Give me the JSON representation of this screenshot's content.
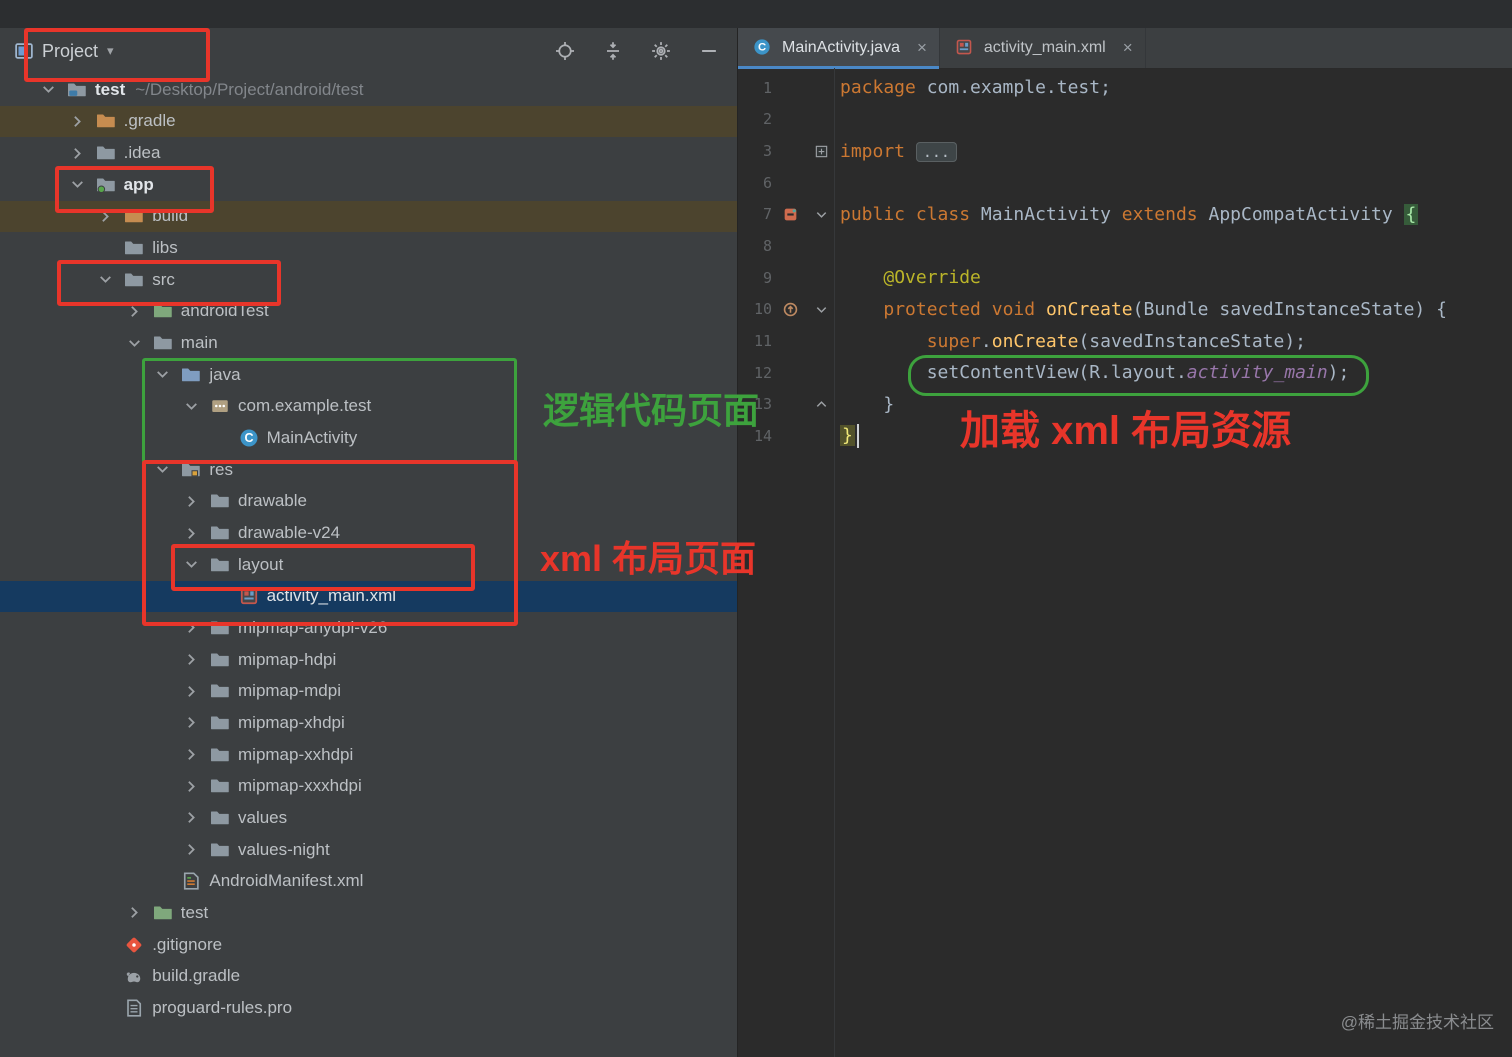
{
  "window": {
    "watermark": "@稀土掘金技术社区"
  },
  "colors": {
    "annotation_red": "#e8352a",
    "annotation_green": "#3da23d",
    "selection_blue": "#153a60",
    "modified_row": "#4c442e",
    "keyword_orange": "#cc7832",
    "editor_bg": "#2b2b2b",
    "panel_bg": "#3c3f41",
    "tab_underline": "#4a88c7"
  },
  "project_panel": {
    "header": {
      "title": "Project",
      "caret": "▾",
      "icons": [
        "locate",
        "collapse-all",
        "settings",
        "hide"
      ]
    },
    "tree": [
      {
        "label": "test",
        "suffix": "~/Desktop/Project/android/test",
        "level": 0,
        "chevron": "expanded",
        "icon": "folder-root",
        "bold": true
      },
      {
        "label": ".gradle",
        "level": 1,
        "chevron": "collapsed",
        "icon": "folder-gradle",
        "row": "modified"
      },
      {
        "label": ".idea",
        "level": 1,
        "chevron": "collapsed",
        "icon": "folder"
      },
      {
        "label": "app",
        "level": 1,
        "chevron": "expanded",
        "icon": "folder-module",
        "bold": true
      },
      {
        "label": "build",
        "level": 2,
        "chevron": "collapsed",
        "icon": "folder-build",
        "row": "modified"
      },
      {
        "label": "libs",
        "level": 2,
        "chevron": null,
        "icon": "folder"
      },
      {
        "label": "src",
        "level": 2,
        "chevron": "expanded",
        "icon": "folder"
      },
      {
        "label": "androidTest",
        "level": 3,
        "chevron": "collapsed",
        "icon": "folder-test"
      },
      {
        "label": "main",
        "level": 3,
        "chevron": "expanded",
        "icon": "folder"
      },
      {
        "label": "java",
        "level": 4,
        "chevron": "expanded",
        "icon": "folder-src"
      },
      {
        "label": "com.example.test",
        "level": 5,
        "chevron": "expanded",
        "icon": "package"
      },
      {
        "label": "MainActivity",
        "level": 6,
        "chevron": null,
        "icon": "class"
      },
      {
        "label": "res",
        "level": 4,
        "chevron": "expanded",
        "icon": "folder-res"
      },
      {
        "label": "drawable",
        "level": 5,
        "chevron": "collapsed",
        "icon": "folder"
      },
      {
        "label": "drawable-v24",
        "level": 5,
        "chevron": "collapsed",
        "icon": "folder"
      },
      {
        "label": "layout",
        "level": 5,
        "chevron": "expanded",
        "icon": "folder"
      },
      {
        "label": "activity_main.xml",
        "level": 6,
        "chevron": null,
        "icon": "layout-xml",
        "row": "selected"
      },
      {
        "label": "mipmap-anydpi-v26",
        "level": 5,
        "chevron": "collapsed",
        "icon": "folder"
      },
      {
        "label": "mipmap-hdpi",
        "level": 5,
        "chevron": "collapsed",
        "icon": "folder"
      },
      {
        "label": "mipmap-mdpi",
        "level": 5,
        "chevron": "collapsed",
        "icon": "folder"
      },
      {
        "label": "mipmap-xhdpi",
        "level": 5,
        "chevron": "collapsed",
        "icon": "folder"
      },
      {
        "label": "mipmap-xxhdpi",
        "level": 5,
        "chevron": "collapsed",
        "icon": "folder"
      },
      {
        "label": "mipmap-xxxhdpi",
        "level": 5,
        "chevron": "collapsed",
        "icon": "folder"
      },
      {
        "label": "values",
        "level": 5,
        "chevron": "collapsed",
        "icon": "folder"
      },
      {
        "label": "values-night",
        "level": 5,
        "chevron": "collapsed",
        "icon": "folder"
      },
      {
        "label": "AndroidManifest.xml",
        "level": 4,
        "chevron": null,
        "icon": "manifest"
      },
      {
        "label": "test",
        "level": 3,
        "chevron": "collapsed",
        "icon": "folder-test"
      },
      {
        "label": ".gitignore",
        "level": 2,
        "chevron": null,
        "icon": "gitignore"
      },
      {
        "label": "build.gradle",
        "level": 2,
        "chevron": null,
        "icon": "gradle-file"
      },
      {
        "label": "proguard-rules.pro",
        "level": 2,
        "chevron": null,
        "icon": "file"
      }
    ]
  },
  "editor": {
    "tabs": [
      {
        "label": "MainActivity.java",
        "icon": "class",
        "active": true,
        "close": "×"
      },
      {
        "label": "activity_main.xml",
        "icon": "layout-xml",
        "active": false,
        "close": "×"
      }
    ],
    "lines": [
      {
        "num": "1",
        "tokens": [
          [
            "kw",
            "package"
          ],
          [
            "pl",
            " com.example.test;"
          ]
        ]
      },
      {
        "num": "2",
        "tokens": []
      },
      {
        "num": "3",
        "fold": "plus",
        "tokens": [
          [
            "kw",
            "import"
          ],
          [
            "pl",
            " "
          ],
          [
            "folded",
            "..."
          ]
        ]
      },
      {
        "num": "6",
        "tokens": []
      },
      {
        "num": "7",
        "gutter": "class",
        "fold": "down",
        "tokens": [
          [
            "kw",
            "public"
          ],
          [
            "pl",
            " "
          ],
          [
            "kw",
            "class"
          ],
          [
            "pl",
            " MainActivity "
          ],
          [
            "kw",
            "extends"
          ],
          [
            "pl",
            " AppCompatActivity "
          ],
          [
            "braceo",
            "{"
          ]
        ]
      },
      {
        "num": "8",
        "tokens": []
      },
      {
        "num": "9",
        "tokens": [
          [
            "pl",
            "    "
          ],
          [
            "ann",
            "@Override"
          ]
        ]
      },
      {
        "num": "10",
        "gutter": "override",
        "fold": "down",
        "tokens": [
          [
            "pl",
            "    "
          ],
          [
            "kw",
            "protected"
          ],
          [
            "pl",
            " "
          ],
          [
            "kw",
            "void"
          ],
          [
            "pl",
            " "
          ],
          [
            "mth",
            "onCreate"
          ],
          [
            "pl",
            "(Bundle savedInstanceState) {"
          ]
        ]
      },
      {
        "num": "11",
        "tokens": [
          [
            "pl",
            "        "
          ],
          [
            "kw",
            "super"
          ],
          [
            "pl",
            "."
          ],
          [
            "mth",
            "onCreate"
          ],
          [
            "pl",
            "(savedInstanceState);"
          ]
        ]
      },
      {
        "num": "12",
        "tokens": [
          [
            "pl",
            "        setContentView(R.layout."
          ],
          [
            "fld",
            "activity_main"
          ],
          [
            "pl",
            ");"
          ]
        ]
      },
      {
        "num": "13",
        "fold": "up",
        "tokens": [
          [
            "pl",
            "    }"
          ]
        ]
      },
      {
        "num": "14",
        "cursor": true,
        "tokens": [
          [
            "bracec",
            "}"
          ]
        ]
      }
    ]
  },
  "annotations": {
    "java_label": "逻辑代码页面",
    "layout_label": "xml 布局页面",
    "editor_label": "加载 xml 布局资源"
  }
}
